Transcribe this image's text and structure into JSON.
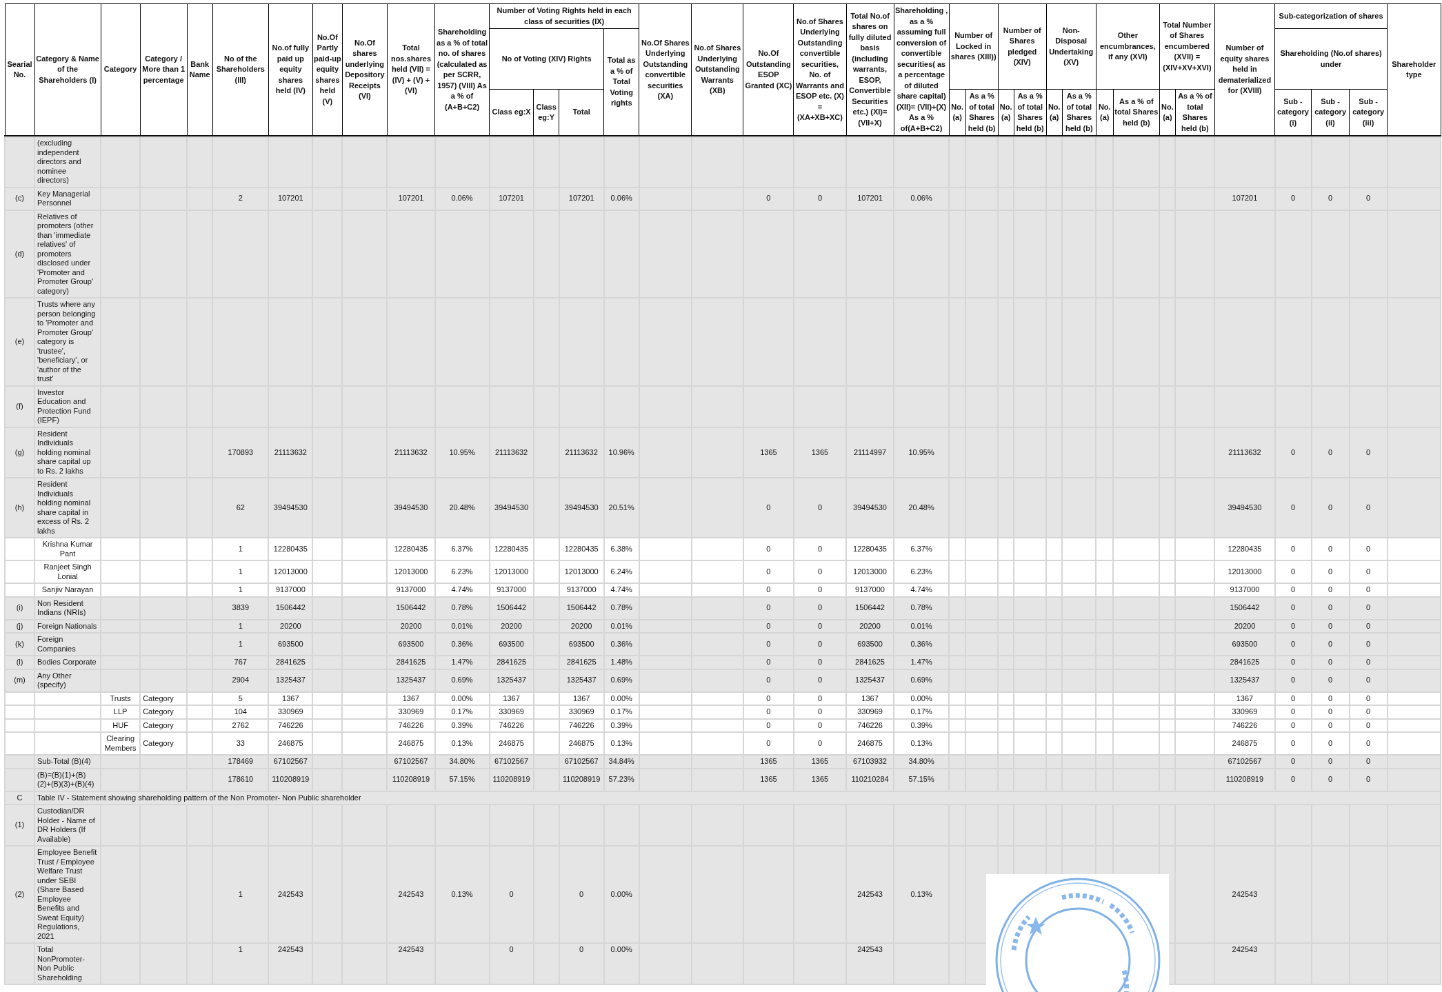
{
  "table": {
    "columns": [
      {
        "label": "Searial No."
      },
      {
        "label": "Category & Name of the Shareholders (I)"
      },
      {
        "label": "Category"
      },
      {
        "label": "Category / More than 1 percentage"
      },
      {
        "label": "Bank Name"
      },
      {
        "label": "No of the Shareholders (III)"
      },
      {
        "label": "No.of fully paid up equity shares held (IV)"
      },
      {
        "label": "No.Of Partly paid-up equity shares held (V)"
      },
      {
        "label": "No.Of shares underlying Depository Receipts (VI)"
      },
      {
        "label": "Total nos.shares held (VII) = (IV) + (V) + (VI)"
      },
      {
        "label": "Shareholding as a % of total no. of shares (calculated as per SCRR, 1957) (VIII) As a % of (A+B+C2)"
      },
      {
        "label": "Number of Voting Rights held in each class of securities (IX)",
        "colspan": 4,
        "children": [
          {
            "label": "No of Voting (XIV) Rights",
            "colspan": 3,
            "children": [
              {
                "label": "Class eg:X"
              },
              {
                "label": "Class eg:Y"
              },
              {
                "label": "Total"
              }
            ]
          },
          {
            "label": "Total as a % of Total Voting rights"
          }
        ]
      },
      {
        "label": "No.Of Shares Underlying Outstanding convertible securities (XA)"
      },
      {
        "label": "No.of Shares Underlying Outstanding Warrants (XB)"
      },
      {
        "label": "No.Of Outstanding ESOP Granted (XC)"
      },
      {
        "label": "No.of Shares Underlying Outstanding convertible securities, No. of Warrants and ESOP etc. (X) = (XA+XB+XC)"
      },
      {
        "label": "Total No.of shares on fully diluted basis (including warrants, ESOP, Convertible Securities etc.) (XI)= (VII+X)"
      },
      {
        "label": "Shareholding , as a % assuming full conversion of convertible securities( as a percentage of diluted share capital) (XII)= (VII)+(X) As a % of(A+B+C2)"
      },
      {
        "label": "Number of Locked in shares (XIII))",
        "colspan": 2,
        "children": [
          {
            "label": "No. (a)"
          },
          {
            "label": "As a % of total Shares held (b)"
          }
        ]
      },
      {
        "label": "Number of Shares pledged (XIV)",
        "colspan": 2,
        "children": [
          {
            "label": "No. (a)"
          },
          {
            "label": "As a % of total Shares held (b)"
          }
        ]
      },
      {
        "label": "Non-Disposal Undertaking (XV)",
        "colspan": 2,
        "children": [
          {
            "label": "No. (a)"
          },
          {
            "label": "As a % of total Shares held (b)"
          }
        ]
      },
      {
        "label": "Other encumbrances, if any (XVI)",
        "colspan": 2,
        "children": [
          {
            "label": "No. (a)"
          },
          {
            "label": "As a % of total Shares held (b)"
          }
        ]
      },
      {
        "label": "Total Number of Shares encumbered (XVII) = (XIV+XV+XVI)",
        "colspan": 2,
        "children": [
          {
            "label": "No. (a)"
          },
          {
            "label": "As a % of total Shares held (b)"
          }
        ]
      },
      {
        "label": "Number of equity shares held in dematerialized for (XVIII)"
      },
      {
        "label": "Sub-categorization of shares",
        "colspan": 3,
        "children": [
          {
            "label": "Shareholding (No.of shares) under",
            "colspan": 3,
            "children": [
              {
                "label": "Sub - category (i)"
              },
              {
                "label": "Sub - category (ii)"
              },
              {
                "label": "Sub - category (iii)"
              }
            ]
          }
        ]
      },
      {
        "label": "Shareholder type"
      }
    ],
    "rows": [
      {
        "kind": "group",
        "cells": [
          null,
          "(excluding independent directors and nominee directors)"
        ]
      },
      {
        "kind": "group",
        "cells": [
          "(c)",
          "Key Managerial Personnel",
          null,
          null,
          null,
          "2",
          "107201",
          null,
          null,
          "107201",
          "0.06%",
          "107201",
          null,
          "107201",
          "0.06%",
          null,
          null,
          "0",
          "0",
          "107201",
          "0.06%",
          null,
          null,
          null,
          null,
          null,
          null,
          null,
          null,
          null,
          null,
          "107201",
          "0",
          "0",
          "0"
        ]
      },
      {
        "kind": "group",
        "cells": [
          "(d)",
          "Relatives of promoters (other than 'immediate relatives' of promoters disclosed under 'Promoter and Promoter Group' category)"
        ]
      },
      {
        "kind": "group",
        "cells": [
          "(e)",
          "Trusts where any person belonging to 'Promoter and Promoter Group' category is 'trustee', 'beneficiary', or 'author of the trust'"
        ]
      },
      {
        "kind": "group",
        "cells": [
          "(f)",
          "Investor Education and Protection Fund (IEPF)"
        ]
      },
      {
        "kind": "group",
        "cells": [
          "(g)",
          "Resident Individuals holding nominal share capital up to Rs. 2 lakhs",
          null,
          null,
          null,
          "170893",
          "21113632",
          null,
          null,
          "21113632",
          "10.95%",
          "21113632",
          null,
          "21113632",
          "10.96%",
          null,
          null,
          "1365",
          "1365",
          "21114997",
          "10.95%",
          null,
          null,
          null,
          null,
          null,
          null,
          null,
          null,
          null,
          null,
          "21113632",
          "0",
          "0",
          "0"
        ]
      },
      {
        "kind": "group",
        "cells": [
          "(h)",
          "Resident Individuals holding nominal share capital in excess of Rs. 2 lakhs",
          null,
          null,
          null,
          "62",
          "39494530",
          null,
          null,
          "39494530",
          "20.48%",
          "39494530",
          null,
          "39494530",
          "20.51%",
          null,
          null,
          "0",
          "0",
          "39494530",
          "20.48%",
          null,
          null,
          null,
          null,
          null,
          null,
          null,
          null,
          null,
          null,
          "39494530",
          "0",
          "0",
          "0"
        ]
      },
      {
        "kind": "detail",
        "cells": [
          null,
          "Krishna Kumar Pant",
          null,
          null,
          null,
          "1",
          "12280435",
          null,
          null,
          "12280435",
          "6.37%",
          "12280435",
          null,
          "12280435",
          "6.38%",
          null,
          null,
          "0",
          "0",
          "12280435",
          "6.37%",
          null,
          null,
          null,
          null,
          null,
          null,
          null,
          null,
          null,
          null,
          "12280435",
          "0",
          "0",
          "0"
        ]
      },
      {
        "kind": "detail",
        "cells": [
          null,
          "Ranjeet Singh Lonial",
          null,
          null,
          null,
          "1",
          "12013000",
          null,
          null,
          "12013000",
          "6.23%",
          "12013000",
          null,
          "12013000",
          "6.24%",
          null,
          null,
          "0",
          "0",
          "12013000",
          "6.23%",
          null,
          null,
          null,
          null,
          null,
          null,
          null,
          null,
          null,
          null,
          "12013000",
          "0",
          "0",
          "0"
        ]
      },
      {
        "kind": "detail",
        "cells": [
          null,
          "Sanjiv Narayan",
          null,
          null,
          null,
          "1",
          "9137000",
          null,
          null,
          "9137000",
          "4.74%",
          "9137000",
          null,
          "9137000",
          "4.74%",
          null,
          null,
          "0",
          "0",
          "9137000",
          "4.74%",
          null,
          null,
          null,
          null,
          null,
          null,
          null,
          null,
          null,
          null,
          "9137000",
          "0",
          "0",
          "0"
        ]
      },
      {
        "kind": "group",
        "cells": [
          "(i)",
          "Non Resident Indians (NRIs)",
          null,
          null,
          null,
          "3839",
          "1506442",
          null,
          null,
          "1506442",
          "0.78%",
          "1506442",
          null,
          "1506442",
          "0.78%",
          null,
          null,
          "0",
          "0",
          "1506442",
          "0.78%",
          null,
          null,
          null,
          null,
          null,
          null,
          null,
          null,
          null,
          null,
          "1506442",
          "0",
          "0",
          "0"
        ]
      },
      {
        "kind": "group",
        "cells": [
          "(j)",
          "Foreign Nationals",
          null,
          null,
          null,
          "1",
          "20200",
          null,
          null,
          "20200",
          "0.01%",
          "20200",
          null,
          "20200",
          "0.01%",
          null,
          null,
          "0",
          "0",
          "20200",
          "0.01%",
          null,
          null,
          null,
          null,
          null,
          null,
          null,
          null,
          null,
          null,
          "20200",
          "0",
          "0",
          "0"
        ]
      },
      {
        "kind": "group",
        "cells": [
          "(k)",
          "Foreign Companies",
          null,
          null,
          null,
          "1",
          "693500",
          null,
          null,
          "693500",
          "0.36%",
          "693500",
          null,
          "693500",
          "0.36%",
          null,
          null,
          "0",
          "0",
          "693500",
          "0.36%",
          null,
          null,
          null,
          null,
          null,
          null,
          null,
          null,
          null,
          null,
          "693500",
          "0",
          "0",
          "0"
        ]
      },
      {
        "kind": "group",
        "cells": [
          "(l)",
          "Bodies Corporate",
          null,
          null,
          null,
          "767",
          "2841625",
          null,
          null,
          "2841625",
          "1.47%",
          "2841625",
          null,
          "2841625",
          "1.48%",
          null,
          null,
          "0",
          "0",
          "2841625",
          "1.47%",
          null,
          null,
          null,
          null,
          null,
          null,
          null,
          null,
          null,
          null,
          "2841625",
          "0",
          "0",
          "0"
        ]
      },
      {
        "kind": "group",
        "cells": [
          "(m)",
          "Any Other (specify)",
          null,
          null,
          null,
          "2904",
          "1325437",
          null,
          null,
          "1325437",
          "0.69%",
          "1325437",
          null,
          "1325437",
          "0.69%",
          null,
          null,
          "0",
          "0",
          "1325437",
          "0.69%",
          null,
          null,
          null,
          null,
          null,
          null,
          null,
          null,
          null,
          null,
          "1325437",
          "0",
          "0",
          "0"
        ]
      },
      {
        "kind": "detail",
        "cells": [
          null,
          null,
          "Trusts",
          "Category",
          null,
          "5",
          "1367",
          null,
          null,
          "1367",
          "0.00%",
          "1367",
          null,
          "1367",
          "0.00%",
          null,
          null,
          "0",
          "0",
          "1367",
          "0.00%",
          null,
          null,
          null,
          null,
          null,
          null,
          null,
          null,
          null,
          null,
          "1367",
          "0",
          "0",
          "0"
        ]
      },
      {
        "kind": "detail",
        "cells": [
          null,
          null,
          "LLP",
          "Category",
          null,
          "104",
          "330969",
          null,
          null,
          "330969",
          "0.17%",
          "330969",
          null,
          "330969",
          "0.17%",
          null,
          null,
          "0",
          "0",
          "330969",
          "0.17%",
          null,
          null,
          null,
          null,
          null,
          null,
          null,
          null,
          null,
          null,
          "330969",
          "0",
          "0",
          "0"
        ]
      },
      {
        "kind": "detail",
        "cells": [
          null,
          null,
          "HUF",
          "Category",
          null,
          "2762",
          "746226",
          null,
          null,
          "746226",
          "0.39%",
          "746226",
          null,
          "746226",
          "0.39%",
          null,
          null,
          "0",
          "0",
          "746226",
          "0.39%",
          null,
          null,
          null,
          null,
          null,
          null,
          null,
          null,
          null,
          null,
          "746226",
          "0",
          "0",
          "0"
        ]
      },
      {
        "kind": "detail",
        "cells": [
          null,
          null,
          "Clearing Members",
          "Category",
          null,
          "33",
          "246875",
          null,
          null,
          "246875",
          "0.13%",
          "246875",
          null,
          "246875",
          "0.13%",
          null,
          null,
          "0",
          "0",
          "246875",
          "0.13%",
          null,
          null,
          null,
          null,
          null,
          null,
          null,
          null,
          null,
          null,
          "246875",
          "0",
          "0",
          "0"
        ]
      },
      {
        "kind": "group",
        "cells": [
          null,
          "Sub-Total (B)(4)",
          null,
          null,
          null,
          "178469",
          "67102567",
          null,
          null,
          "67102567",
          "34.80%",
          "67102567",
          null,
          "67102567",
          "34.84%",
          null,
          null,
          "1365",
          "1365",
          "67103932",
          "34.80%",
          null,
          null,
          null,
          null,
          null,
          null,
          null,
          null,
          null,
          null,
          "67102567",
          "0",
          "0",
          "0"
        ]
      },
      {
        "kind": "group",
        "cells": [
          null,
          "(B)=(B)(1)+(B)(2)+(B)(3)+(B)(4)",
          null,
          null,
          null,
          "178610",
          "110208919",
          null,
          null,
          "110208919",
          "57.15%",
          "110208919",
          null,
          "110208919",
          "57.23%",
          null,
          null,
          "1365",
          "1365",
          "110210284",
          "57.15%",
          null,
          null,
          null,
          null,
          null,
          null,
          null,
          null,
          null,
          null,
          "110208919",
          "0",
          "0",
          "0"
        ]
      },
      {
        "kind": "section",
        "cells": [
          "C",
          {
            "text": "Table IV - Statement showing shareholding pattern of the Non Promoter- Non Public shareholder",
            "colspan": 35
          }
        ]
      },
      {
        "kind": "group",
        "cells": [
          "(1)",
          "Custodian/DR Holder - Name of DR Holders (If Available)"
        ]
      },
      {
        "kind": "group",
        "cells": [
          "(2)",
          "Employee Benefit Trust / Employee Welfare Trust under SEBI (Share Based Employee Benefits and Sweat Equity) Regulations, 2021",
          null,
          null,
          null,
          "1",
          "242543",
          null,
          null,
          "242543",
          "0.13%",
          "0",
          null,
          "0",
          "0.00%",
          null,
          null,
          null,
          null,
          "242543",
          "0.13%",
          null,
          null,
          null,
          null,
          null,
          null,
          null,
          null,
          null,
          null,
          "242543"
        ]
      },
      {
        "kind": "total",
        "cells": [
          null,
          "Total NonPromoter- Non Public Shareholding",
          null,
          null,
          null,
          "1",
          "242543",
          null,
          null,
          "242543",
          null,
          "0",
          null,
          "0",
          "0.00%",
          null,
          null,
          null,
          null,
          "242543",
          null,
          null,
          null,
          null,
          null,
          null,
          null,
          null,
          null,
          null,
          null,
          "242543"
        ]
      }
    ]
  }
}
